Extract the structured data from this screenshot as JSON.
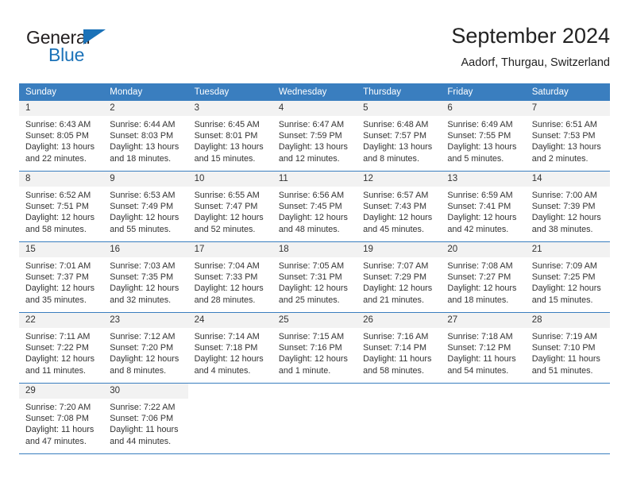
{
  "brand": {
    "line1": "General",
    "line2": "Blue",
    "triangle_color": "#1b72b8"
  },
  "header": {
    "title": "September 2024",
    "subtitle": "Aadorf, Thurgau, Switzerland"
  },
  "theme": {
    "header_bg": "#3a7ebf",
    "daynum_bg": "#f2f2f2",
    "text": "#333333",
    "rule": "#3a7ebf"
  },
  "weekday_headers": [
    "Sunday",
    "Monday",
    "Tuesday",
    "Wednesday",
    "Thursday",
    "Friday",
    "Saturday"
  ],
  "weeks": [
    [
      {
        "day": "1",
        "sunrise": "Sunrise: 6:43 AM",
        "sunset": "Sunset: 8:05 PM",
        "daylight": "Daylight: 13 hours and 22 minutes."
      },
      {
        "day": "2",
        "sunrise": "Sunrise: 6:44 AM",
        "sunset": "Sunset: 8:03 PM",
        "daylight": "Daylight: 13 hours and 18 minutes."
      },
      {
        "day": "3",
        "sunrise": "Sunrise: 6:45 AM",
        "sunset": "Sunset: 8:01 PM",
        "daylight": "Daylight: 13 hours and 15 minutes."
      },
      {
        "day": "4",
        "sunrise": "Sunrise: 6:47 AM",
        "sunset": "Sunset: 7:59 PM",
        "daylight": "Daylight: 13 hours and 12 minutes."
      },
      {
        "day": "5",
        "sunrise": "Sunrise: 6:48 AM",
        "sunset": "Sunset: 7:57 PM",
        "daylight": "Daylight: 13 hours and 8 minutes."
      },
      {
        "day": "6",
        "sunrise": "Sunrise: 6:49 AM",
        "sunset": "Sunset: 7:55 PM",
        "daylight": "Daylight: 13 hours and 5 minutes."
      },
      {
        "day": "7",
        "sunrise": "Sunrise: 6:51 AM",
        "sunset": "Sunset: 7:53 PM",
        "daylight": "Daylight: 13 hours and 2 minutes."
      }
    ],
    [
      {
        "day": "8",
        "sunrise": "Sunrise: 6:52 AM",
        "sunset": "Sunset: 7:51 PM",
        "daylight": "Daylight: 12 hours and 58 minutes."
      },
      {
        "day": "9",
        "sunrise": "Sunrise: 6:53 AM",
        "sunset": "Sunset: 7:49 PM",
        "daylight": "Daylight: 12 hours and 55 minutes."
      },
      {
        "day": "10",
        "sunrise": "Sunrise: 6:55 AM",
        "sunset": "Sunset: 7:47 PM",
        "daylight": "Daylight: 12 hours and 52 minutes."
      },
      {
        "day": "11",
        "sunrise": "Sunrise: 6:56 AM",
        "sunset": "Sunset: 7:45 PM",
        "daylight": "Daylight: 12 hours and 48 minutes."
      },
      {
        "day": "12",
        "sunrise": "Sunrise: 6:57 AM",
        "sunset": "Sunset: 7:43 PM",
        "daylight": "Daylight: 12 hours and 45 minutes."
      },
      {
        "day": "13",
        "sunrise": "Sunrise: 6:59 AM",
        "sunset": "Sunset: 7:41 PM",
        "daylight": "Daylight: 12 hours and 42 minutes."
      },
      {
        "day": "14",
        "sunrise": "Sunrise: 7:00 AM",
        "sunset": "Sunset: 7:39 PM",
        "daylight": "Daylight: 12 hours and 38 minutes."
      }
    ],
    [
      {
        "day": "15",
        "sunrise": "Sunrise: 7:01 AM",
        "sunset": "Sunset: 7:37 PM",
        "daylight": "Daylight: 12 hours and 35 minutes."
      },
      {
        "day": "16",
        "sunrise": "Sunrise: 7:03 AM",
        "sunset": "Sunset: 7:35 PM",
        "daylight": "Daylight: 12 hours and 32 minutes."
      },
      {
        "day": "17",
        "sunrise": "Sunrise: 7:04 AM",
        "sunset": "Sunset: 7:33 PM",
        "daylight": "Daylight: 12 hours and 28 minutes."
      },
      {
        "day": "18",
        "sunrise": "Sunrise: 7:05 AM",
        "sunset": "Sunset: 7:31 PM",
        "daylight": "Daylight: 12 hours and 25 minutes."
      },
      {
        "day": "19",
        "sunrise": "Sunrise: 7:07 AM",
        "sunset": "Sunset: 7:29 PM",
        "daylight": "Daylight: 12 hours and 21 minutes."
      },
      {
        "day": "20",
        "sunrise": "Sunrise: 7:08 AM",
        "sunset": "Sunset: 7:27 PM",
        "daylight": "Daylight: 12 hours and 18 minutes."
      },
      {
        "day": "21",
        "sunrise": "Sunrise: 7:09 AM",
        "sunset": "Sunset: 7:25 PM",
        "daylight": "Daylight: 12 hours and 15 minutes."
      }
    ],
    [
      {
        "day": "22",
        "sunrise": "Sunrise: 7:11 AM",
        "sunset": "Sunset: 7:22 PM",
        "daylight": "Daylight: 12 hours and 11 minutes."
      },
      {
        "day": "23",
        "sunrise": "Sunrise: 7:12 AM",
        "sunset": "Sunset: 7:20 PM",
        "daylight": "Daylight: 12 hours and 8 minutes."
      },
      {
        "day": "24",
        "sunrise": "Sunrise: 7:14 AM",
        "sunset": "Sunset: 7:18 PM",
        "daylight": "Daylight: 12 hours and 4 minutes."
      },
      {
        "day": "25",
        "sunrise": "Sunrise: 7:15 AM",
        "sunset": "Sunset: 7:16 PM",
        "daylight": "Daylight: 12 hours and 1 minute."
      },
      {
        "day": "26",
        "sunrise": "Sunrise: 7:16 AM",
        "sunset": "Sunset: 7:14 PM",
        "daylight": "Daylight: 11 hours and 58 minutes."
      },
      {
        "day": "27",
        "sunrise": "Sunrise: 7:18 AM",
        "sunset": "Sunset: 7:12 PM",
        "daylight": "Daylight: 11 hours and 54 minutes."
      },
      {
        "day": "28",
        "sunrise": "Sunrise: 7:19 AM",
        "sunset": "Sunset: 7:10 PM",
        "daylight": "Daylight: 11 hours and 51 minutes."
      }
    ],
    [
      {
        "day": "29",
        "sunrise": "Sunrise: 7:20 AM",
        "sunset": "Sunset: 7:08 PM",
        "daylight": "Daylight: 11 hours and 47 minutes."
      },
      {
        "day": "30",
        "sunrise": "Sunrise: 7:22 AM",
        "sunset": "Sunset: 7:06 PM",
        "daylight": "Daylight: 11 hours and 44 minutes."
      },
      {
        "day": "",
        "sunrise": "",
        "sunset": "",
        "daylight": ""
      },
      {
        "day": "",
        "sunrise": "",
        "sunset": "",
        "daylight": ""
      },
      {
        "day": "",
        "sunrise": "",
        "sunset": "",
        "daylight": ""
      },
      {
        "day": "",
        "sunrise": "",
        "sunset": "",
        "daylight": ""
      },
      {
        "day": "",
        "sunrise": "",
        "sunset": "",
        "daylight": ""
      }
    ]
  ]
}
